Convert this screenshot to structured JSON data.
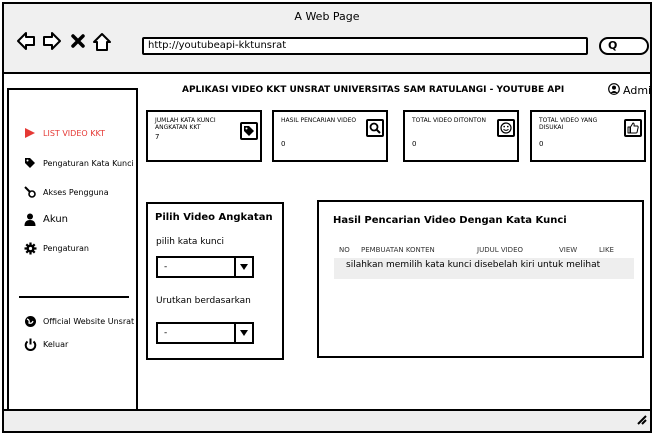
{
  "window": {
    "title": "A Web Page",
    "url": "http://youtubeapi-kktunsrat"
  },
  "header": {
    "app_title": "APLIKASI VIDEO KKT UNSRAT UNIVERSITAS SAM RATULANGI - YOUTUBE API",
    "user_label": "Admin"
  },
  "sidebar": {
    "items": [
      {
        "label": "LIST VIDEO KKT",
        "icon": "triangle-right-icon",
        "active": true
      },
      {
        "label": "Pengaturan Kata Kunci",
        "icon": "tag-icon"
      },
      {
        "label": "Akses Pengguna",
        "icon": "key-icon"
      },
      {
        "label": "Akun",
        "icon": "user-icon"
      },
      {
        "label": "Pengaturan",
        "icon": "gear-icon"
      },
      {
        "label": "Official Website Unsrat",
        "icon": "globe-icon"
      },
      {
        "label": "Keluar",
        "icon": "power-icon"
      }
    ]
  },
  "stats": [
    {
      "label": "JUMLAH KATA KUNCI ANGKATAN KKT",
      "value": "7",
      "icon": "tag-icon"
    },
    {
      "label": "HASIL PENCARIAN VIDEO",
      "value": "0",
      "icon": "search-icon"
    },
    {
      "label": "TOTAL VIDEO DITONTON",
      "value": "0",
      "icon": "smiley-icon"
    },
    {
      "label": "TOTAL VIDEO YANG DISUKAI",
      "value": "0",
      "icon": "thumbs-up-icon"
    }
  ],
  "filter": {
    "title": "Pilih Video Angkatan",
    "keyword_label": "pilih kata kunci",
    "keyword_value": "-",
    "sort_label": "Urutkan berdasarkan",
    "sort_value": "-"
  },
  "results": {
    "title": "Hasil Pencarian Video Dengan Kata Kunci",
    "columns": [
      "NO",
      "PEMBUATAN KONTEN",
      "JUDUL VIDEO",
      "VIEW",
      "LIKE"
    ],
    "empty_message": "silahkan memilih kata kunci disebelah kiri untuk melihat"
  },
  "colors": {
    "active": "#e53935",
    "chrome": "#f0f0f0",
    "border": "#000000"
  }
}
